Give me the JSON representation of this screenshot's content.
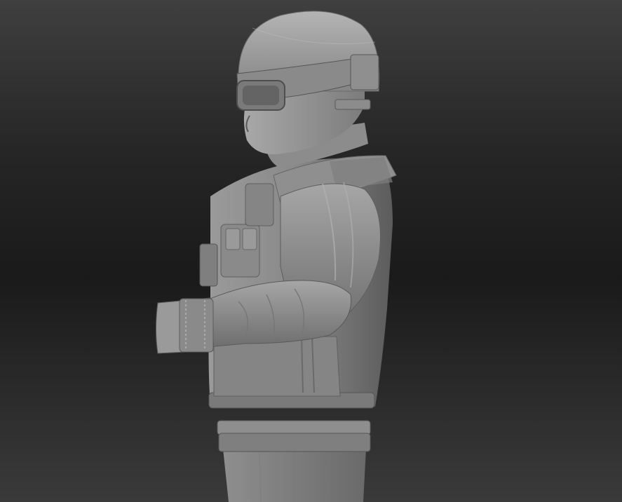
{
  "viewport": {
    "background_top": "#3f3f3f",
    "background_bottom": "#3a3a3a",
    "model_base_color": "#8c8c8c",
    "model_highlight_color": "#c4c4c4",
    "model_shadow_color": "#4a4a4a"
  },
  "model": {
    "subject": "soldier-bust-sculpt",
    "view": "side-profile-facing-left",
    "parts": [
      "helmet",
      "goggles",
      "head",
      "neck",
      "tactical-vest",
      "arm",
      "sleeve-cuff",
      "belt",
      "trousers"
    ]
  }
}
